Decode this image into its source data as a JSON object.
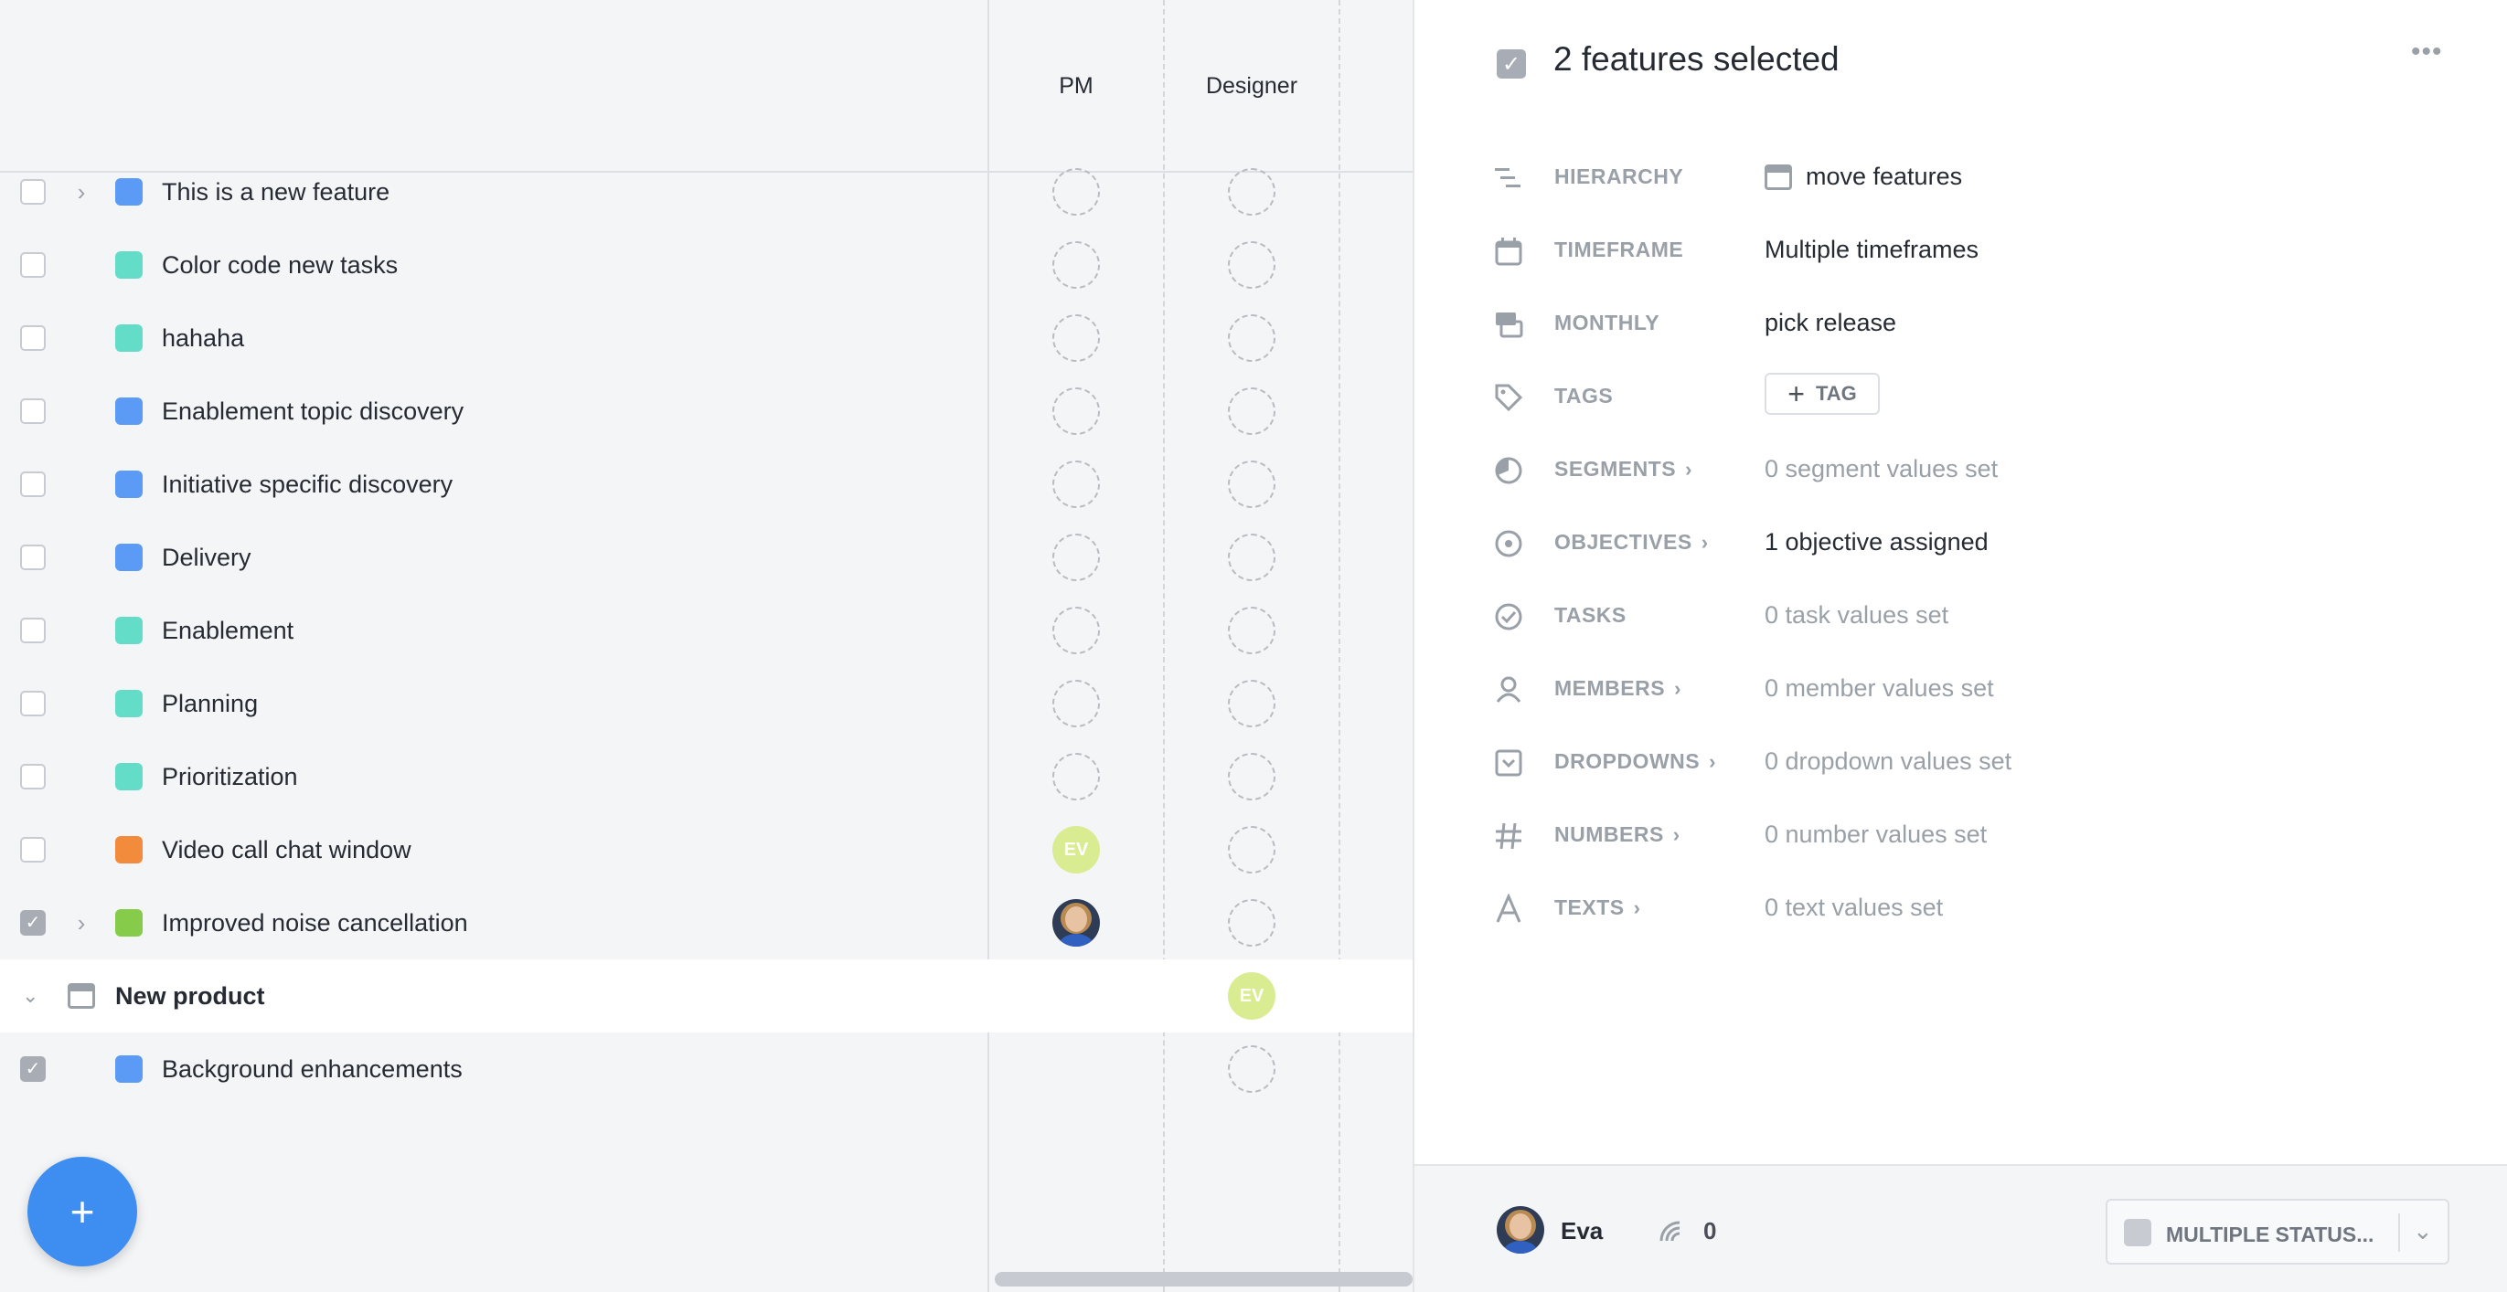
{
  "columns": {
    "pm": "PM",
    "designer": "Designer"
  },
  "colors": {
    "blue": "#5b9bf5",
    "teal": "#63dcc8",
    "orange": "#f28b3c",
    "green": "#86cc4a"
  },
  "features": [
    {
      "title": "This is a new feature",
      "color": "#5b9bf5",
      "expander": true,
      "checked": false,
      "pm": "empty",
      "designer": "empty"
    },
    {
      "title": "Color code new tasks",
      "color": "#63dcc8",
      "expander": false,
      "checked": false,
      "pm": "empty",
      "designer": "empty"
    },
    {
      "title": "hahaha",
      "color": "#63dcc8",
      "expander": false,
      "checked": false,
      "pm": "empty",
      "designer": "empty"
    },
    {
      "title": "Enablement topic discovery",
      "color": "#5b9bf5",
      "expander": false,
      "checked": false,
      "pm": "empty",
      "designer": "empty"
    },
    {
      "title": "Initiative specific discovery",
      "color": "#5b9bf5",
      "expander": false,
      "checked": false,
      "pm": "empty",
      "designer": "empty"
    },
    {
      "title": "Delivery",
      "color": "#5b9bf5",
      "expander": false,
      "checked": false,
      "pm": "empty",
      "designer": "empty"
    },
    {
      "title": "Enablement",
      "color": "#63dcc8",
      "expander": false,
      "checked": false,
      "pm": "empty",
      "designer": "empty"
    },
    {
      "title": "Planning",
      "color": "#63dcc8",
      "expander": false,
      "checked": false,
      "pm": "empty",
      "designer": "empty"
    },
    {
      "title": "Prioritization",
      "color": "#63dcc8",
      "expander": false,
      "checked": false,
      "pm": "empty",
      "designer": "empty"
    },
    {
      "title": "Video call chat window",
      "color": "#f28b3c",
      "expander": false,
      "checked": false,
      "pm": "EV",
      "designer": "empty"
    },
    {
      "title": "Improved noise cancellation",
      "color": "#86cc4a",
      "expander": true,
      "checked": true,
      "pm": "photo",
      "designer": "empty"
    }
  ],
  "group": {
    "title": "New product",
    "designer": "EV"
  },
  "group_features": [
    {
      "title": "Background enhancements",
      "color": "#5b9bf5",
      "checked": true,
      "designer": "empty"
    }
  ],
  "fab": {
    "label": "+"
  },
  "panel": {
    "title": "2 features selected",
    "more": "•••",
    "properties": [
      {
        "id": "hierarchy",
        "label": "HIERARCHY",
        "value": "move features",
        "chevron": false,
        "muted": false
      },
      {
        "id": "timeframe",
        "label": "TIMEFRAME",
        "value": "Multiple timeframes",
        "chevron": false,
        "muted": false
      },
      {
        "id": "monthly",
        "label": "MONTHLY",
        "value": "pick release",
        "chevron": false,
        "muted": false
      },
      {
        "id": "tags",
        "label": "TAGS",
        "value": "TAG",
        "chevron": false,
        "muted": false
      },
      {
        "id": "segments",
        "label": "SEGMENTS",
        "value": "0 segment values set",
        "chevron": true,
        "muted": true
      },
      {
        "id": "objectives",
        "label": "OBJECTIVES",
        "value": "1 objective assigned",
        "chevron": true,
        "muted": false
      },
      {
        "id": "tasks",
        "label": "TASKS",
        "value": "0 task values set",
        "chevron": false,
        "muted": true
      },
      {
        "id": "members",
        "label": "MEMBERS",
        "value": "0 member values set",
        "chevron": true,
        "muted": true
      },
      {
        "id": "dropdowns",
        "label": "DROPDOWNS",
        "value": "0 dropdown values set",
        "chevron": true,
        "muted": true
      },
      {
        "id": "numbers",
        "label": "NUMBERS",
        "value": "0 number values set",
        "chevron": true,
        "muted": true
      },
      {
        "id": "texts",
        "label": "TEXTS",
        "value": "0 text values set",
        "chevron": true,
        "muted": true
      }
    ],
    "footer": {
      "user": "Eva",
      "count": "0",
      "status": "MULTIPLE STATUS..."
    }
  }
}
